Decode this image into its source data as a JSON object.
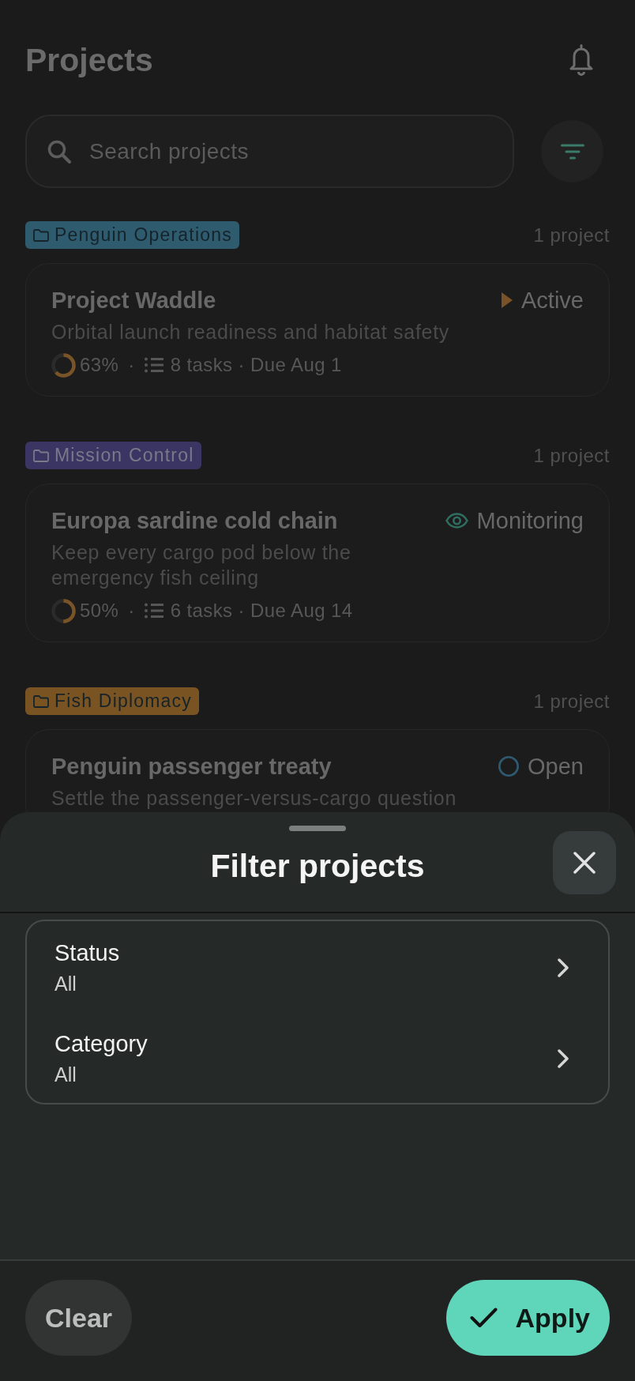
{
  "header": {
    "title": "Projects"
  },
  "search": {
    "placeholder": "Search projects"
  },
  "groups": [
    {
      "category": {
        "label": "Penguin Operations",
        "color": "#2f5b6f"
      },
      "count": "1 project",
      "projects": [
        {
          "title": "Project Waddle",
          "status": {
            "kind": "active",
            "label": "Active"
          },
          "description": "Orbital launch readiness and habitat safety",
          "progress": {
            "level": 0.63,
            "reading": "63%"
          },
          "separator": "·",
          "summary": "8 tasks · Due Aug 1"
        }
      ]
    },
    {
      "category": {
        "label": "Mission Control",
        "color": "#3b3563"
      },
      "count": "1 project",
      "projects": [
        {
          "title": "Europa sardine cold chain",
          "status": {
            "kind": "monitoring",
            "label": "Monitoring"
          },
          "description": "Keep every cargo pod below the emergency fish ceiling",
          "progress": {
            "level": 0.5,
            "reading": "50%"
          },
          "separator": "·",
          "summary": "6 tasks · Due Aug 14"
        }
      ]
    },
    {
      "category": {
        "label": "Fish Diplomacy",
        "color": "#7a5322"
      },
      "count": "1 project",
      "projects": [
        {
          "title": "Penguin passenger treaty",
          "status": {
            "kind": "open",
            "label": "Open"
          },
          "description": "Settle the passenger-versus-cargo question"
        }
      ]
    }
  ],
  "filter_sheet": {
    "title": "Filter projects",
    "filters": [
      {
        "label": "Status",
        "value": "All"
      },
      {
        "label": "Category",
        "value": "All"
      }
    ],
    "buttons": [
      {
        "kind": "clear",
        "label": "Clear"
      },
      {
        "kind": "apply",
        "label": "Apply"
      }
    ]
  }
}
